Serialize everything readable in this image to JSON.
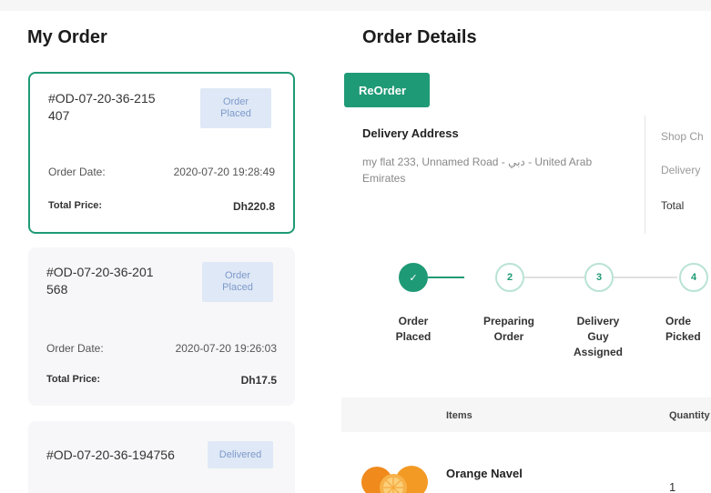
{
  "my_order": {
    "title": "My Order",
    "orders": [
      {
        "id": "#OD-07-20-36-215407",
        "status": "Order Placed",
        "date_label": "Order Date:",
        "date": "2020-07-20 19:28:49",
        "total_label": "Total Price:",
        "total": "Dh220.8"
      },
      {
        "id": "#OD-07-20-36-201568",
        "status": "Order Placed",
        "date_label": "Order Date:",
        "date": "2020-07-20 19:26:03",
        "total_label": "Total Price:",
        "total": "Dh17.5"
      },
      {
        "id": "#OD-07-20-36-194756",
        "status": "Delivered"
      }
    ]
  },
  "order_details": {
    "title": "Order Details",
    "reorder_label": "ReOrder",
    "delivery_address_label": "Delivery Address",
    "delivery_address": "my flat 233, Unnamed Road - دبي - United Arab Emirates",
    "summary": {
      "shop_charges_label": "Shop Ch",
      "delivery_label": "Delivery",
      "total_label": "Total"
    },
    "steps": [
      {
        "num": "✓",
        "label_line1": "Order",
        "label_line2": "Placed",
        "label_line3": "",
        "done": true
      },
      {
        "num": "2",
        "label_line1": "Preparing",
        "label_line2": "Order",
        "label_line3": "",
        "done": false
      },
      {
        "num": "3",
        "label_line1": "Delivery",
        "label_line2": "Guy",
        "label_line3": "Assigned",
        "done": false
      },
      {
        "num": "4",
        "label_line1": "Orde",
        "label_line2": "Picked",
        "label_line3": "",
        "done": false
      }
    ],
    "table": {
      "items_header": "Items",
      "quantity_header": "Quantity",
      "rows": [
        {
          "name": "Orange Navel",
          "quantity": "1",
          "image": "orange-image"
        }
      ]
    }
  },
  "colors": {
    "accent": "#1f9a76",
    "badge_bg": "#dfe8f6",
    "badge_text": "#7d9acb"
  }
}
